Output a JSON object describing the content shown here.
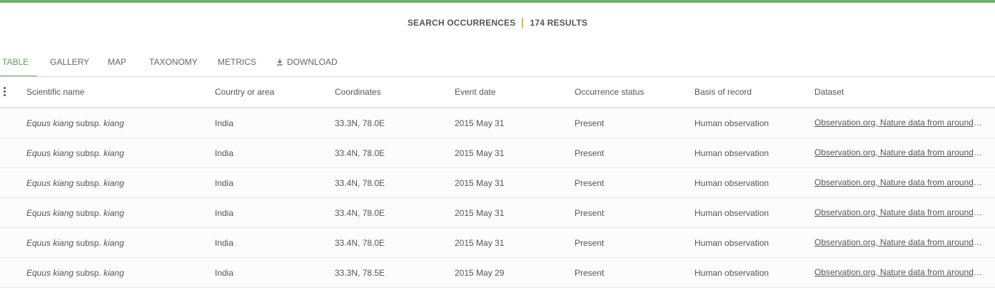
{
  "header": {
    "title": "SEARCH OCCURRENCES",
    "results": "174 RESULTS"
  },
  "tabs": [
    {
      "label": "TABLE",
      "active": true
    },
    {
      "label": "GALLERY",
      "active": false
    },
    {
      "label": "MAP",
      "active": false
    },
    {
      "label": "TAXONOMY",
      "active": false
    },
    {
      "label": "METRICS",
      "active": false
    },
    {
      "label": "DOWNLOAD",
      "active": false,
      "icon": "download-icon"
    }
  ],
  "table": {
    "columns": [
      "Scientific name",
      "Country or area",
      "Coordinates",
      "Event date",
      "Occurrence status",
      "Basis of record",
      "Dataset"
    ],
    "rows": [
      {
        "genus": "Equus kiang",
        "rank": "subsp.",
        "epithet": "kiang",
        "country": "India",
        "coords": "33.3N, 78.0E",
        "date": "2015 May 31",
        "status": "Present",
        "basis": "Human observation",
        "dataset": "Observation.org, Nature data from around the World"
      },
      {
        "genus": "Equus kiang",
        "rank": "subsp.",
        "epithet": "kiang",
        "country": "India",
        "coords": "33.4N, 78.0E",
        "date": "2015 May 31",
        "status": "Present",
        "basis": "Human observation",
        "dataset": "Observation.org, Nature data from around the World"
      },
      {
        "genus": "Equus kiang",
        "rank": "subsp.",
        "epithet": "kiang",
        "country": "India",
        "coords": "33.4N, 78.0E",
        "date": "2015 May 31",
        "status": "Present",
        "basis": "Human observation",
        "dataset": "Observation.org, Nature data from around the World"
      },
      {
        "genus": "Equus kiang",
        "rank": "subsp.",
        "epithet": "kiang",
        "country": "India",
        "coords": "33.4N, 78.0E",
        "date": "2015 May 31",
        "status": "Present",
        "basis": "Human observation",
        "dataset": "Observation.org, Nature data from around the World"
      },
      {
        "genus": "Equus kiang",
        "rank": "subsp.",
        "epithet": "kiang",
        "country": "India",
        "coords": "33.4N, 78.0E",
        "date": "2015 May 31",
        "status": "Present",
        "basis": "Human observation",
        "dataset": "Observation.org, Nature data from around the World"
      },
      {
        "genus": "Equus kiang",
        "rank": "subsp.",
        "epithet": "kiang",
        "country": "India",
        "coords": "33.3N, 78.5E",
        "date": "2015 May 29",
        "status": "Present",
        "basis": "Human observation",
        "dataset": "Observation.org, Nature data from around the World"
      }
    ]
  },
  "colors": {
    "accent": "#71b171",
    "separator": "#e8b52e"
  }
}
